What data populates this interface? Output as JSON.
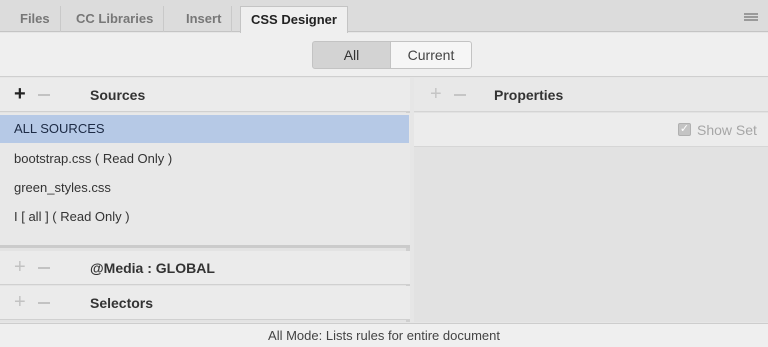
{
  "tabs": [
    {
      "label": "Files"
    },
    {
      "label": "CC Libraries"
    },
    {
      "label": "Insert"
    },
    {
      "label": "CSS Designer"
    }
  ],
  "mode_toggle": {
    "all_label": "All",
    "current_label": "Current",
    "selected": "All"
  },
  "sources": {
    "plus": "+",
    "title": "Sources",
    "items": [
      {
        "label": "ALL SOURCES"
      },
      {
        "label": "bootstrap.css  ( Read Only )"
      },
      {
        "label": "green_styles.css"
      },
      {
        "label": "I  [ all ]  ( Read Only )"
      }
    ]
  },
  "media": {
    "plus": "+",
    "title": "@Media :  GLOBAL"
  },
  "selectors": {
    "plus": "+",
    "title": "Selectors"
  },
  "properties": {
    "plus": "+",
    "title": "Properties",
    "show_set_label": "Show Set",
    "show_set_checked": true
  },
  "status": {
    "text": "All Mode: Lists rules for entire document"
  },
  "colors": {
    "selected_row": "#b6c9e6",
    "panel_bg": "#e3e3e3"
  }
}
